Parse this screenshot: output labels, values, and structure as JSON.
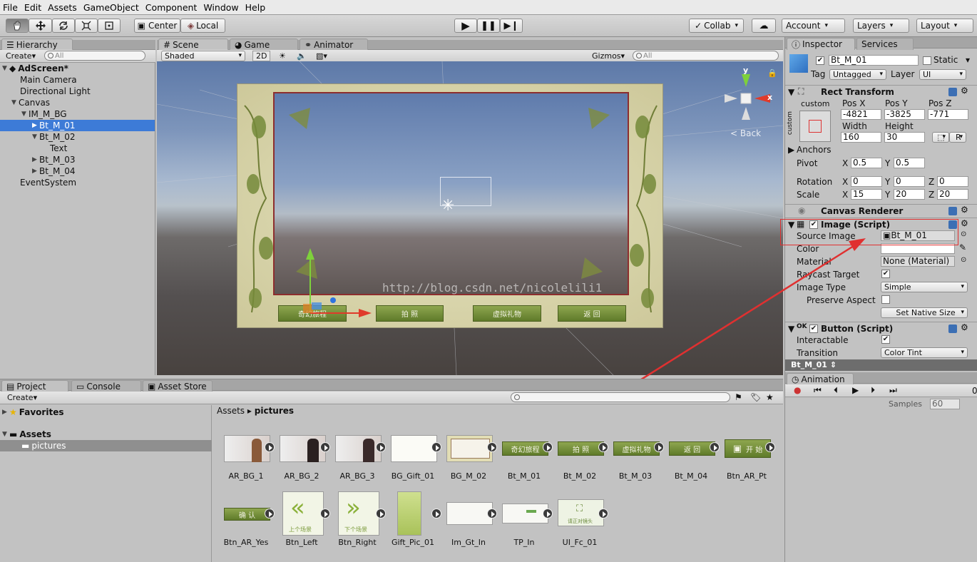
{
  "menu": [
    "File",
    "Edit",
    "Assets",
    "GameObject",
    "Component",
    "Window",
    "Help"
  ],
  "toolbar": {
    "pivot": "Center",
    "space": "Local",
    "collab": "Collab",
    "account": "Account",
    "layers": "Layers",
    "layout": "Layout"
  },
  "hierarchy": {
    "tab": "Hierarchy",
    "create": "Create",
    "search": "All",
    "scene": "AdScreen*",
    "items": [
      "Main Camera",
      "Directional Light",
      "Canvas",
      "IM_M_BG",
      "Bt_M_01",
      "Bt_M_02",
      "Text",
      "Bt_M_03",
      "Bt_M_04",
      "EventSystem"
    ]
  },
  "scene_tabs": {
    "scene": "Scene",
    "game": "Game",
    "animator": "Animator"
  },
  "scene_bar": {
    "shaded": "Shaded",
    "mode2d": "2D",
    "gizmos": "Gizmos",
    "search": "All",
    "back": "Back",
    "axis_y": "y",
    "axis_x": "x"
  },
  "scene_buttons": [
    "奇幻旅程",
    "拍 照",
    "虚拟礼物",
    "返 回"
  ],
  "watermark": "http://blog.csdn.net/nicolelili1",
  "inspector": {
    "tab": "Inspector",
    "services": "Services",
    "name": "Bt_M_01",
    "static": "Static",
    "tag_label": "Tag",
    "tag": "Untagged",
    "layer_label": "Layer",
    "layer": "UI",
    "rect": "Rect Transform",
    "custom": "custom",
    "custom_v": "custom",
    "posx_l": "Pos X",
    "posy_l": "Pos Y",
    "posz_l": "Pos Z",
    "posx": "-4821",
    "posy": "-3825",
    "posz": "-771",
    "width_l": "Width",
    "height_l": "Height",
    "width": "160",
    "height": "30",
    "r": "R",
    "anchors": "Anchors",
    "pivot": "Pivot",
    "px_l": "X",
    "py_l": "Y",
    "pivot_x": "0.5",
    "pivot_y": "0.5",
    "rotation": "Rotation",
    "rx": "0",
    "ry": "0",
    "rz": "0",
    "scale": "Scale",
    "sx": "15",
    "sy": "20",
    "sz": "20",
    "x": "X",
    "y": "Y",
    "z": "Z",
    "canvas_renderer": "Canvas Renderer",
    "image": "Image (Script)",
    "source_image": "Source Image",
    "source_val": "Bt_M_01",
    "color": "Color",
    "material": "Material",
    "material_val": "None (Material)",
    "raycast": "Raycast Target",
    "image_type": "Image Type",
    "image_type_val": "Simple",
    "preserve": "Preserve Aspect",
    "set_native": "Set Native Size",
    "button": "Button (Script)",
    "interactable": "Interactable",
    "transition": "Transition",
    "transition_val": "Color Tint",
    "footer": "Bt_M_01"
  },
  "animation": {
    "tab": "Animation",
    "samples": "Samples",
    "samples_val": "60",
    "frame": "0"
  },
  "project": {
    "tab": "Project",
    "console": "Console",
    "store": "Asset Store",
    "create": "Create",
    "favorites": "Favorites",
    "assets": "Assets",
    "folder": "pictures",
    "crumb_root": "Assets",
    "crumb_cur": "pictures"
  },
  "assets_row1": [
    "AR_BG_1",
    "AR_BG_2",
    "AR_BG_3",
    "BG_Gift_01",
    "BG_M_02",
    "Bt_M_01",
    "Bt_M_02",
    "Bt_M_03",
    "Bt_M_04",
    "Btn_AR_Pt"
  ],
  "assets_row2": [
    "Btn_AR_Yes",
    "Btn_Left",
    "Btn_Right",
    "Gift_Pic_01",
    "Im_Gt_In",
    "TP_In",
    "UI_Fc_01"
  ],
  "thumb_text": {
    "bt1": "奇幻旅程",
    "bt2": "拍 照",
    "bt3": "虚拟礼物",
    "bt4": "返 回",
    "pt": "开 始",
    "yes": "确 认",
    "left": "上个场景",
    "right": "下个场景",
    "fc": "请正对镜头"
  }
}
